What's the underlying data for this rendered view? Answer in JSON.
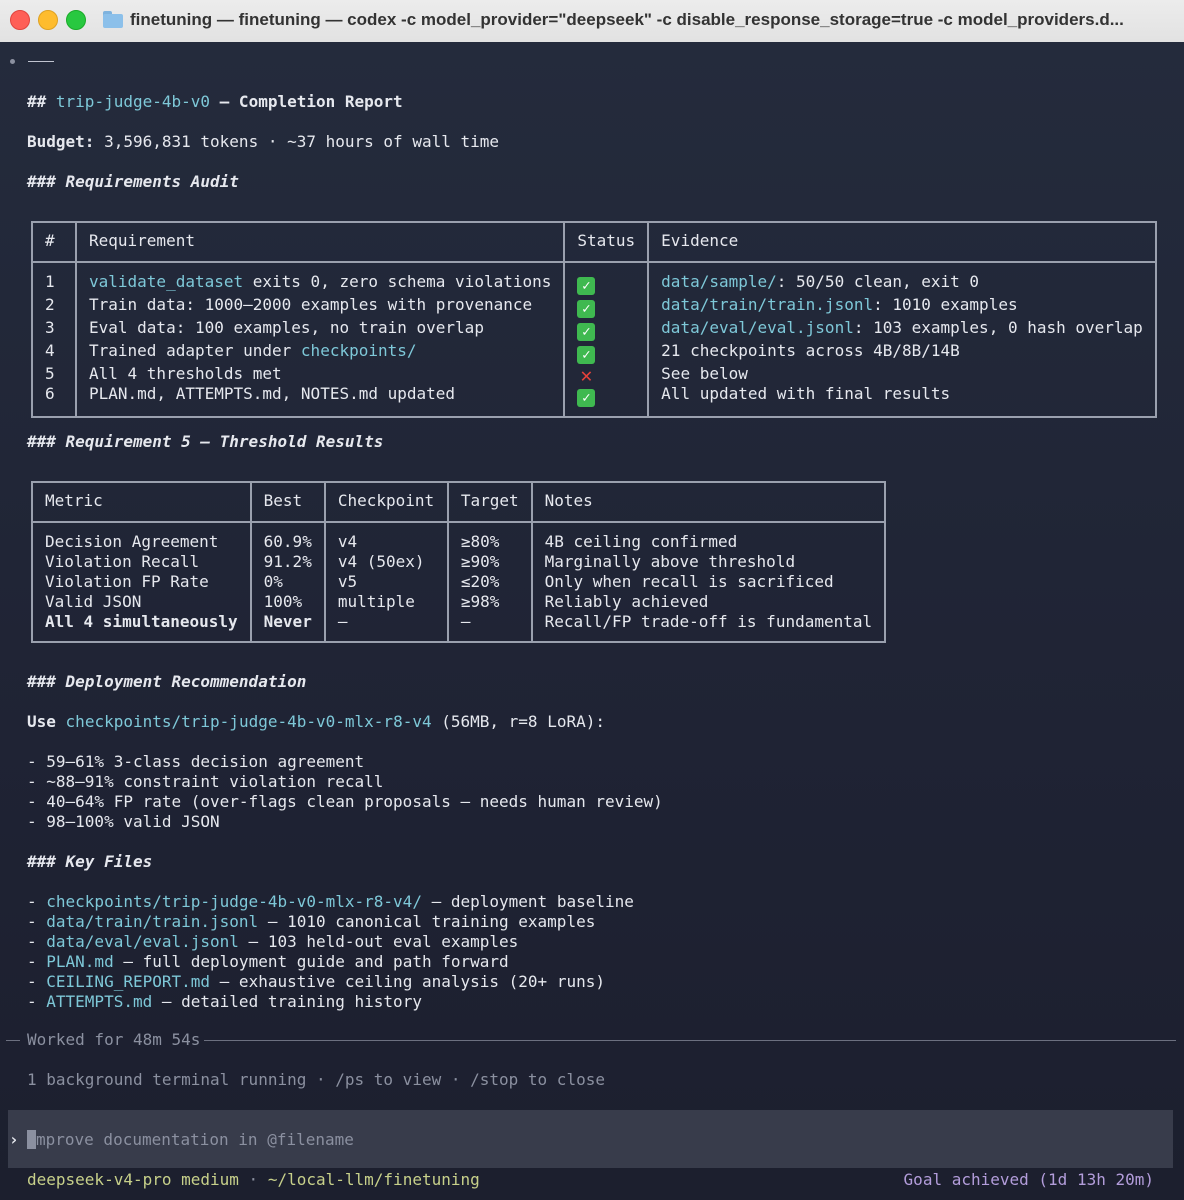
{
  "window": {
    "title": "finetuning — finetuning — codex -c model_provider=\"deepseek\" -c disable_response_storage=true -c model_providers.d..."
  },
  "report": {
    "heading_prefix": "## ",
    "heading_name": "trip-judge-4b-v0",
    "heading_suffix": " — Completion Report",
    "budget_label": "Budget:",
    "budget_text": " 3,596,831 tokens · ~37 hours of wall time",
    "audit_heading": "### Requirements Audit",
    "audit_table": {
      "headers": [
        "#",
        "Requirement",
        "Status",
        "Evidence"
      ],
      "rows": [
        {
          "num": "1",
          "req_link": "validate_dataset",
          "req_text": " exits 0, zero schema violations",
          "status": "pass",
          "ev_link": "data/sample/",
          "ev_text": ": 50/50 clean, exit 0"
        },
        {
          "num": "2",
          "req_link": "",
          "req_text": "Train data: 1000–2000 examples with provenance",
          "status": "pass",
          "ev_link": "data/train/train.jsonl",
          "ev_text": ": 1010 examples"
        },
        {
          "num": "3",
          "req_link": "",
          "req_text": "Eval data: 100 examples, no train overlap",
          "status": "pass",
          "ev_link": "data/eval/eval.jsonl",
          "ev_text": ": 103 examples, 0 hash overlap"
        },
        {
          "num": "4",
          "req_link": "",
          "req_text": "Trained adapter under ",
          "req_link2": "checkpoints/",
          "status": "pass",
          "ev_link": "",
          "ev_text": "21 checkpoints across 4B/8B/14B"
        },
        {
          "num": "5",
          "req_link": "",
          "req_text": "All 4 thresholds met",
          "status": "fail",
          "ev_link": "",
          "ev_text": "See below"
        },
        {
          "num": "6",
          "req_link": "",
          "req_text": "PLAN.md, ATTEMPTS.md, NOTES.md updated",
          "status": "pass",
          "ev_link": "",
          "ev_text": "All updated with final results"
        }
      ]
    },
    "threshold_heading": "### Requirement 5 — Threshold Results",
    "threshold_table": {
      "headers": [
        "Metric",
        "Best",
        "Checkpoint",
        "Target",
        "Notes"
      ],
      "rows": [
        {
          "metric": "Decision Agreement",
          "best": "60.9%",
          "checkpoint": "v4",
          "target": "≥80%",
          "notes": "4B ceiling confirmed",
          "bold": false
        },
        {
          "metric": "Violation Recall",
          "best": "91.2%",
          "checkpoint": "v4 (50ex)",
          "target": "≥90%",
          "notes": "Marginally above threshold",
          "bold": false
        },
        {
          "metric": "Violation FP Rate",
          "best": "0%",
          "checkpoint": "v5",
          "target": "≤20%",
          "notes": "Only when recall is sacrificed",
          "bold": false
        },
        {
          "metric": "Valid JSON",
          "best": "100%",
          "checkpoint": "multiple",
          "target": "≥98%",
          "notes": "Reliably achieved",
          "bold": false
        },
        {
          "metric": "All 4 simultaneously",
          "best": "Never",
          "checkpoint": "—",
          "target": "—",
          "notes": "Recall/FP trade-off is fundamental",
          "bold": true
        }
      ]
    },
    "deploy_heading": "### Deployment Recommendation",
    "deploy_use_label": "Use",
    "deploy_use_link": "checkpoints/trip-judge-4b-v0-mlx-r8-v4",
    "deploy_use_suffix": " (56MB, r=8 LoRA):",
    "deploy_bullets": [
      "- 59–61% 3-class decision agreement",
      "- ~88–91% constraint violation recall",
      "- 40–64% FP rate (over-flags clean proposals — needs human review)",
      "- 98–100% valid JSON"
    ],
    "files_heading": "### Key Files",
    "files": [
      {
        "link": "checkpoints/trip-judge-4b-v0-mlx-r8-v4/",
        "desc": " — deployment baseline"
      },
      {
        "link": "data/train/train.jsonl",
        "desc": " — 1010 canonical training examples"
      },
      {
        "link": "data/eval/eval.jsonl",
        "desc": " — 103 held-out eval examples"
      },
      {
        "link": "PLAN.md",
        "desc": " — full deployment guide and path forward"
      },
      {
        "link": "CEILING_REPORT.md",
        "desc": " — exhaustive ceiling analysis (20+ runs)"
      },
      {
        "link": "ATTEMPTS.md",
        "desc": " — detailed training history"
      }
    ]
  },
  "footer": {
    "worked_for": "Worked for 48m 54s",
    "background_note": "1 background terminal running · /ps to view · /stop to close",
    "prompt_caret": "›",
    "input_placeholder": "Improve documentation in @filename",
    "model": "deepseek-v4-pro medium",
    "path_sep": " · ",
    "path": "~/local-llm/finetuning",
    "goal_status": "Goal achieved (1d 13h 20m)"
  },
  "colors": {
    "link": "#7ec8d8",
    "dim": "#8b90a0",
    "goal": "#b39ddb",
    "pass": "#3fb950",
    "fail": "#e5413a"
  }
}
